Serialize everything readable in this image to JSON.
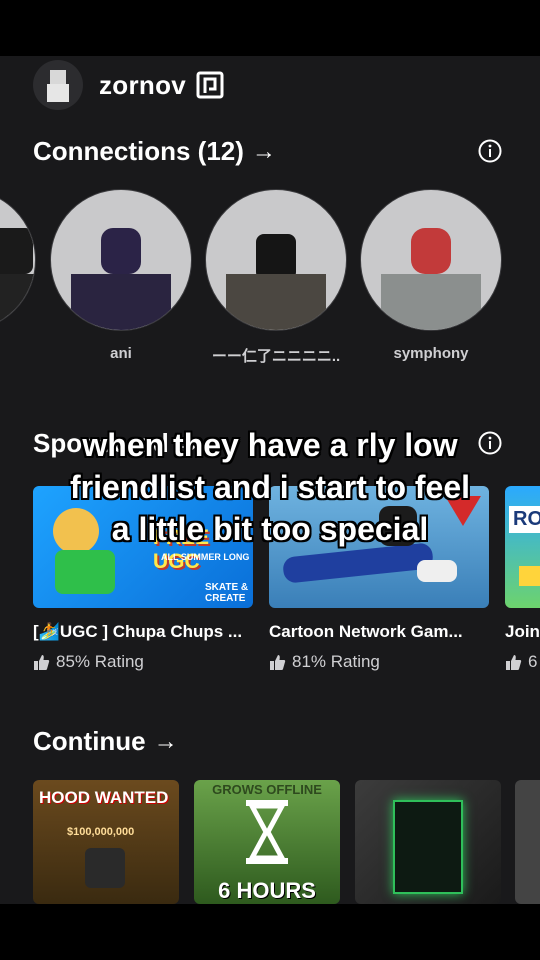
{
  "profile": {
    "username": "zornov"
  },
  "connections": {
    "title": "Connections (12)",
    "arrow": "→",
    "friends": [
      {
        "name": ""
      },
      {
        "name": "ani"
      },
      {
        "name": "ーー仁了ニニニニ.."
      },
      {
        "name": "symphony"
      }
    ]
  },
  "sponsored": {
    "title": "Sponsored",
    "arrow": "→",
    "items": [
      {
        "title": "[🏄UGC ] Chupa Chups ...",
        "rating": "85% Rating",
        "thumb_text": "FREE UGC",
        "thumb_sub": "ALL SUMMER LONG",
        "thumb_corner": "SKATE & CREATE"
      },
      {
        "title": "Cartoon Network Gam...",
        "rating": "81% Rating"
      },
      {
        "title": "Join",
        "rating": "6",
        "thumb_text": "RO"
      }
    ]
  },
  "continue": {
    "title": "Continue",
    "arrow": "→",
    "items": [
      {
        "label": "HOOD WANTED",
        "sub": "$100,000,000"
      },
      {
        "label": "6 HOURS",
        "top": "GROWS OFFLINE"
      },
      {
        "label": ""
      },
      {
        "label": ""
      }
    ]
  },
  "caption": {
    "line1": "when they have a rly low",
    "line2": "friendlist and i start to feel",
    "line3": "a little bit too special"
  },
  "colors": {
    "background": "#19191b",
    "frame": "#000000",
    "text": "#ffffff"
  }
}
